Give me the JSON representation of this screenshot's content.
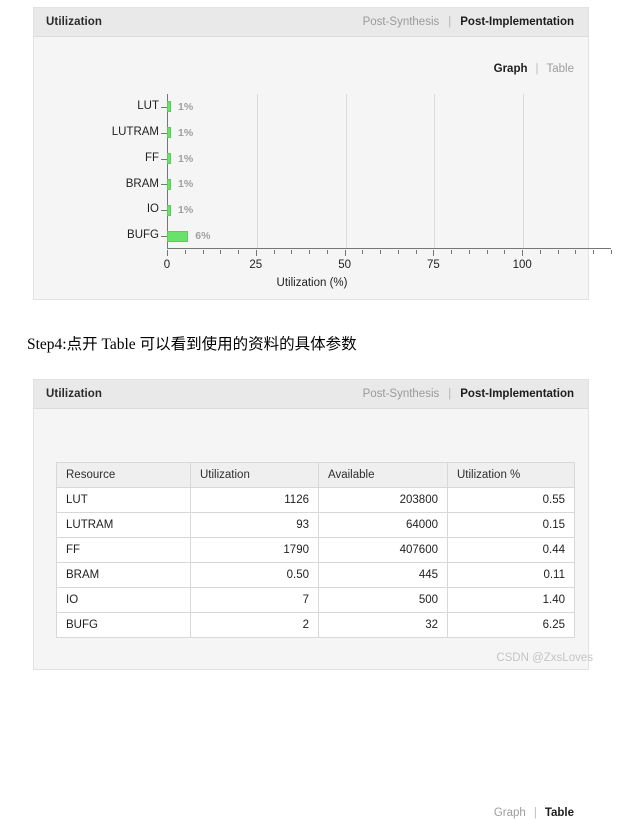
{
  "chart_panel": {
    "title": "Utilization",
    "header_links": {
      "inactive": "Post-Synthesis",
      "separator": "|",
      "active": "Post-Implementation"
    },
    "view_switch": {
      "graph": "Graph",
      "separator": "|",
      "table": "Table",
      "active": "Graph"
    }
  },
  "table_panel": {
    "title": "Utilization",
    "header_links": {
      "inactive": "Post-Synthesis",
      "separator": "|",
      "active": "Post-Implementation"
    },
    "view_switch": {
      "graph": "Graph",
      "separator": "|",
      "table": "Table",
      "active": "Table"
    }
  },
  "step_caption": "Step4:点开 Table 可以看到使用的资料的具体参数",
  "watermark": "CSDN @ZxsLoves",
  "colors": {
    "bar": "#6ae16a",
    "bar_border": "#57cf57",
    "panel_header": "#e9e9e9",
    "panel_body": "#f5f5f5"
  },
  "chart_data": {
    "type": "bar",
    "orientation": "horizontal",
    "title": "Utilization",
    "categories": [
      "LUT",
      "LUTRAM",
      "FF",
      "BRAM",
      "IO",
      "BUFG"
    ],
    "values": [
      1,
      1,
      1,
      1,
      1,
      6
    ],
    "data_labels": [
      "1%",
      "1%",
      "1%",
      "1%",
      "1%",
      "6%"
    ],
    "xlabel": "Utilization (%)",
    "ylabel": "",
    "xlim": [
      0,
      125
    ],
    "xticks": [
      0,
      25,
      50,
      75,
      100
    ],
    "xtick_labels": [
      "0",
      "25",
      "50",
      "75",
      "100"
    ],
    "grid": true,
    "legend": false,
    "series_color": "#6ae16a"
  },
  "table": {
    "columns": [
      "Resource",
      "Utilization",
      "Available",
      "Utilization %"
    ],
    "rows": [
      {
        "resource": "LUT",
        "utilization": "1126",
        "available": "203800",
        "percent": "0.55"
      },
      {
        "resource": "LUTRAM",
        "utilization": "93",
        "available": "64000",
        "percent": "0.15"
      },
      {
        "resource": "FF",
        "utilization": "1790",
        "available": "407600",
        "percent": "0.44"
      },
      {
        "resource": "BRAM",
        "utilization": "0.50",
        "available": "445",
        "percent": "0.11"
      },
      {
        "resource": "IO",
        "utilization": "7",
        "available": "500",
        "percent": "1.40"
      },
      {
        "resource": "BUFG",
        "utilization": "2",
        "available": "32",
        "percent": "6.25"
      }
    ]
  }
}
